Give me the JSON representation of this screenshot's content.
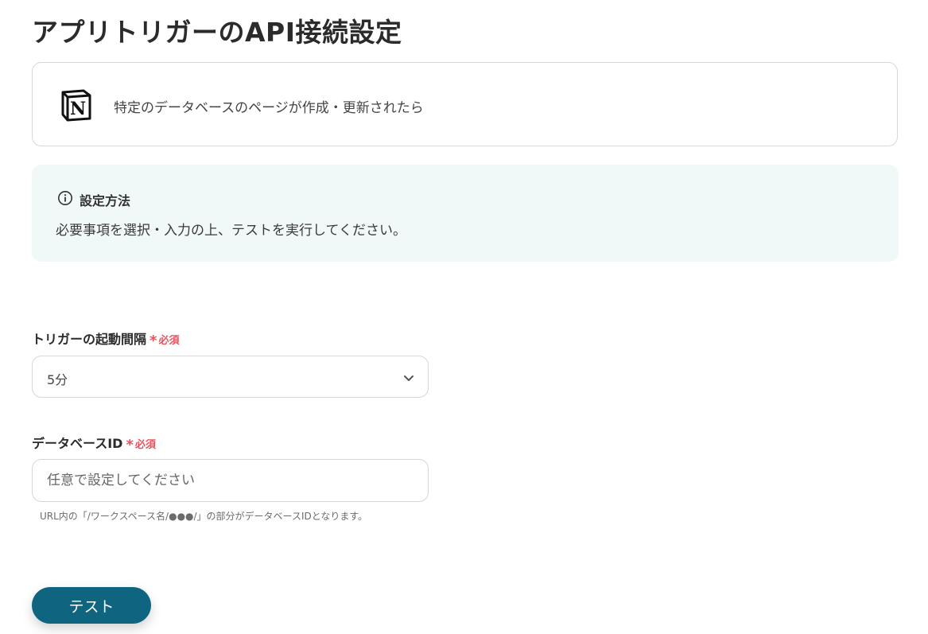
{
  "page": {
    "title": "アプリトリガーのAPI接続設定"
  },
  "trigger": {
    "app_icon": "notion-logo",
    "description": "特定のデータベースのページが作成・更新されたら"
  },
  "info": {
    "icon": "info-icon",
    "title": "設定方法",
    "description": "必要事項を選択・入力の上、テストを実行してください。"
  },
  "fields": {
    "interval": {
      "label": "トリガーの起動間隔",
      "required_star": "*",
      "required_label": "必須",
      "value": "5分"
    },
    "database_id": {
      "label": "データベースID",
      "required_star": "*",
      "required_label": "必須",
      "placeholder": "任意で設定してください",
      "value": "",
      "hint": "URL内の「/ワークスペース名/●●●/」の部分がデータベースIDとなります。"
    }
  },
  "actions": {
    "test_label": "テスト"
  },
  "colors": {
    "accent": "#0f6480",
    "required": "#e5535f",
    "info_bg": "#f1f9f8",
    "border": "#d4d8dc"
  }
}
